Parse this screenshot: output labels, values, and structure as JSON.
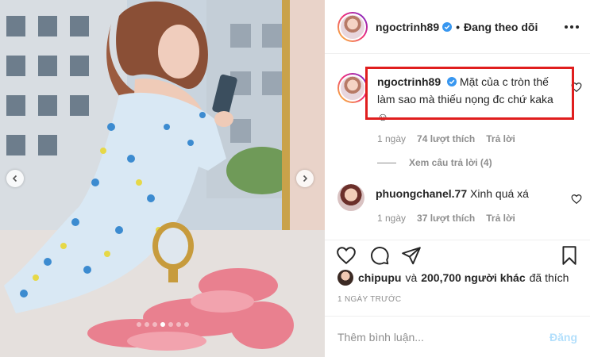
{
  "header": {
    "username": "ngoctrinh89",
    "separator": "•",
    "follow_status": "Đang theo dõi",
    "verified_icon": "verified-badge-icon",
    "more_icon": "more-options-icon"
  },
  "photo": {
    "nav_left_icon": "chevron-left-icon",
    "nav_right_icon": "chevron-right-icon"
  },
  "comments": [
    {
      "username": "ngoctrinh89",
      "text_line1": "Mặt của c tròn thế",
      "text_line2": "làm sao mà thiếu nọng đc chứ kaka",
      "emoji": "☺",
      "time": "1 ngày",
      "likes": "74 lượt thích",
      "reply": "Trả lời"
    },
    {
      "username": "phuongchanel.77",
      "text": "Xinh quá xá",
      "time": "1 ngày",
      "likes": "37 lượt thích",
      "reply": "Trả lời"
    }
  ],
  "view_replies": "Xem câu trả lời (4)",
  "likes_summary": {
    "user": "chipupu",
    "connector": "và",
    "others": "200,700 người khác",
    "suffix": "đã thích"
  },
  "time_ago": "1 NGÀY TRƯỚC",
  "add_comment": {
    "placeholder": "Thêm bình luận...",
    "post_label": "Đăng"
  },
  "colors": {
    "highlight": "#e01e1e",
    "verified": "#3897f0",
    "post_disabled": "#b2dffc"
  }
}
